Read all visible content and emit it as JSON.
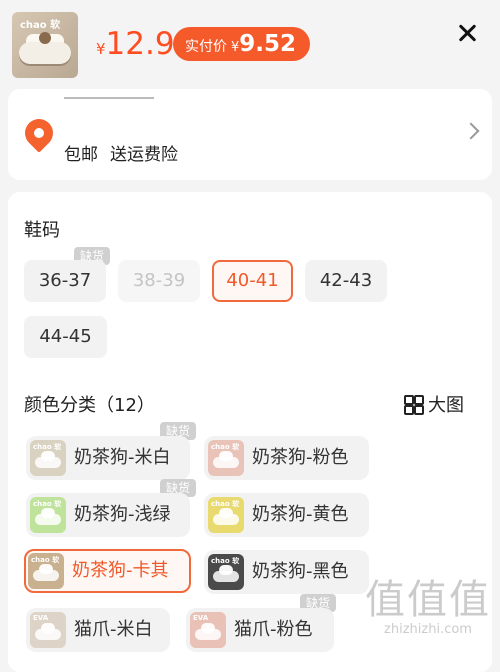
{
  "header": {
    "thumb_brand": "chao 软",
    "price_currency": "¥",
    "price": "12.9",
    "actual_label": "实付价",
    "actual_currency": "¥",
    "actual_price": "9.52"
  },
  "shipping": {
    "items": [
      "包邮",
      "送运费险"
    ]
  },
  "size_section": {
    "title": "鞋码",
    "out_of_stock_badge": "缺货",
    "options": [
      "36-37",
      "38-39",
      "40-41",
      "42-43",
      "44-45"
    ],
    "selected": "40-41",
    "disabled": [
      "38-39"
    ]
  },
  "color_section": {
    "title": "颜色分类（12）",
    "big_view": "大图",
    "out_of_stock_badge": "缺货",
    "options": [
      {
        "label": "奶茶狗-米白",
        "swatch": "#d9d2c0",
        "image_tag": "chao 软"
      },
      {
        "label": "奶茶狗-粉色",
        "swatch": "#e9c3b8",
        "image_tag": "chao 软"
      },
      {
        "label": "奶茶狗-浅绿",
        "swatch": "#bfe39a",
        "image_tag": "chao 软"
      },
      {
        "label": "奶茶狗-黄色",
        "swatch": "#e8da6e",
        "image_tag": "chao 软"
      },
      {
        "label": "奶茶狗-卡其",
        "swatch": "#c9b08f",
        "image_tag": "chao 软"
      },
      {
        "label": "奶茶狗-黑色",
        "swatch": "#4a4a4a",
        "image_tag": "chao 软"
      },
      {
        "label": "猫爪-米白",
        "swatch": "#ddd3c6",
        "image_tag": "EVA"
      },
      {
        "label": "猫爪-粉色",
        "swatch": "#eac1b6",
        "image_tag": "EVA"
      }
    ],
    "selected": "奶茶狗-卡其"
  },
  "watermark": {
    "big": "值值值",
    "small": "zhizhizhi.com"
  },
  "colors": {
    "accent": "#f45a2a",
    "price": "#ff4d22",
    "badge": "#d0d0d0"
  }
}
